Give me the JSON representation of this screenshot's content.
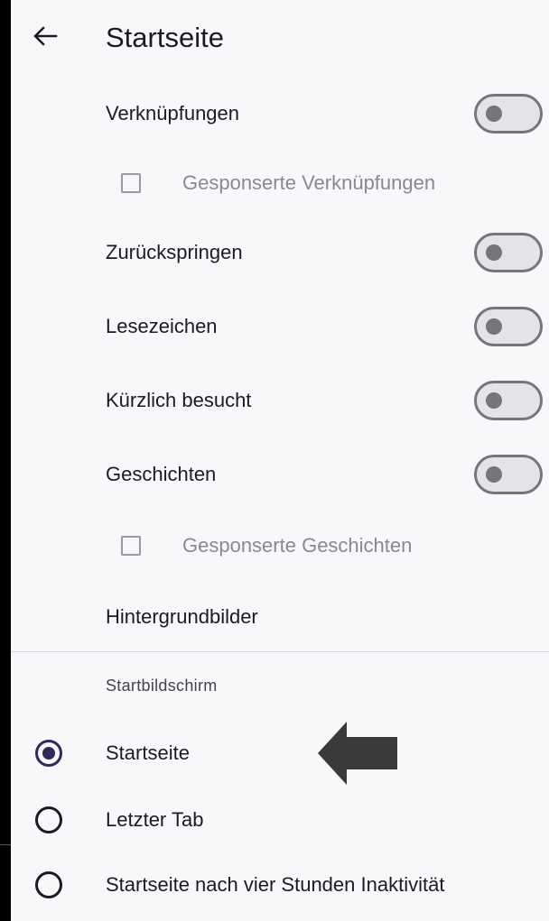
{
  "topbar": {
    "back_icon": "arrow-left-icon",
    "title": "Startseite"
  },
  "settings": [
    {
      "kind": "toggle",
      "label": "Verknüpfungen",
      "on": false
    },
    {
      "kind": "checkbox",
      "label": "Gesponserte Verknüpfungen",
      "checked": false,
      "enabled": false
    },
    {
      "kind": "toggle",
      "label": "Zurückspringen",
      "on": false
    },
    {
      "kind": "toggle",
      "label": "Lesezeichen",
      "on": false
    },
    {
      "kind": "toggle",
      "label": "Kürzlich besucht",
      "on": false
    },
    {
      "kind": "toggle",
      "label": "Geschichten",
      "on": false
    },
    {
      "kind": "checkbox",
      "label": "Gesponserte Geschichten",
      "checked": false,
      "enabled": false
    },
    {
      "kind": "link",
      "label": "Hintergrundbilder"
    }
  ],
  "homescreen": {
    "header": "Startbildschirm",
    "options": [
      {
        "label": "Startseite",
        "selected": true
      },
      {
        "label": "Letzter Tab",
        "selected": false
      },
      {
        "label": "Startseite nach vier Stunden Inaktivität",
        "selected": false
      }
    ]
  },
  "colors": {
    "background": "#f8f7fa",
    "text": "#1d1b20",
    "disabled_text": "#8a8890",
    "radio_accent": "#2f2a5a",
    "toggle_outline": "#77757c",
    "annotation_arrow": "#3a3a3a"
  }
}
